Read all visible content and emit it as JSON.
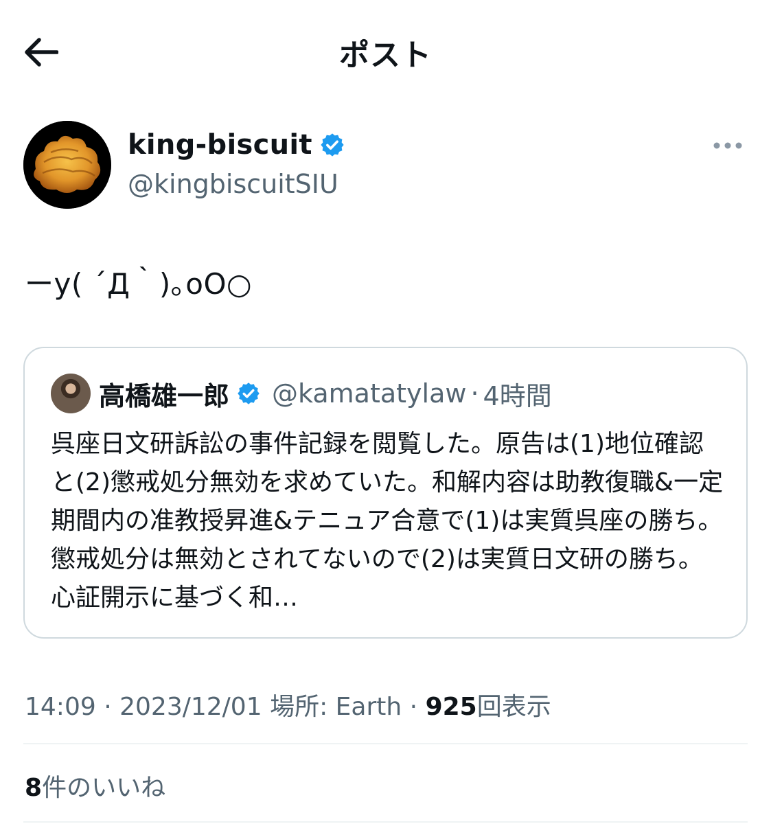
{
  "header": {
    "title": "ポスト",
    "back_icon": "arrow-left-icon"
  },
  "author": {
    "name": "king-biscuit",
    "handle": "@kingbiscuitSIU",
    "verified": true
  },
  "tweet": {
    "text": "ーy( ´Д｀)｡oO○"
  },
  "quote": {
    "name": "高橋雄一郎",
    "handle": "@kamatatylaw",
    "separator": "·",
    "time": "4時間",
    "body": "呉座日文研訴訟の事件記録を閲覧した。原告は(1)地位確認と(2)懲戒処分無効を求めていた。和解内容は助教復職&一定期間内の准教授昇進&テニュア合意で(1)は実質呉座の勝ち。懲戒処分は無効とされてないので(2)は実質日文研の勝ち。心証開示に基づく和…"
  },
  "meta": {
    "time": "14:09",
    "sep1": "·",
    "date": "2023/12/01",
    "location_label": "場所:",
    "location": "Earth",
    "sep2": "·",
    "views": "925",
    "views_label": "回表示"
  },
  "likes": {
    "count": "8",
    "label": "件のいいね"
  },
  "colors": {
    "text_primary": "#0f1419",
    "text_secondary": "#536471",
    "verified_blue": "#1d9bf0",
    "border": "#cfd9de"
  }
}
